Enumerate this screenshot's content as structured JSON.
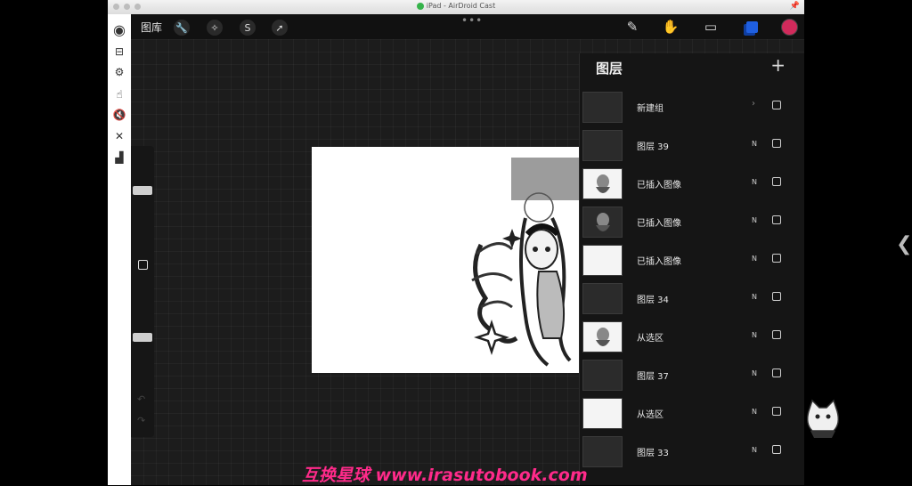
{
  "window": {
    "title": "iPad - AirDroid Cast"
  },
  "topbar": {
    "gallery_label": "图库",
    "tools_left": [
      "wrench-icon",
      "magic-wand-icon",
      "selection-icon",
      "transform-arrow-icon"
    ],
    "tools_right": [
      "brush-icon",
      "smudge-icon",
      "eraser-icon",
      "layers-icon",
      "color-swatch"
    ],
    "active_color": "#d12a5b",
    "layers_icon_color": "#1f5fe0"
  },
  "layers_panel": {
    "title": "图层",
    "add_icon": "plus-icon",
    "layers": [
      {
        "name": "新建组",
        "blend": "",
        "group": true,
        "thumb": "dark"
      },
      {
        "name": "图层 39",
        "blend": "N",
        "thumb": "dark"
      },
      {
        "name": "已插入图像",
        "blend": "N",
        "thumb": "art"
      },
      {
        "name": "已插入图像",
        "blend": "N",
        "thumb": "art-dark"
      },
      {
        "name": "已插入图像",
        "blend": "N",
        "thumb": "white"
      },
      {
        "name": "图层 34",
        "blend": "N",
        "thumb": "dark"
      },
      {
        "name": "从选区",
        "blend": "N",
        "thumb": "art"
      },
      {
        "name": "图层 37",
        "blend": "N",
        "thumb": "dark"
      },
      {
        "name": "从选区",
        "blend": "N",
        "thumb": "white"
      },
      {
        "name": "图层 33",
        "blend": "N",
        "thumb": "dark"
      }
    ]
  },
  "watermark": "互换星球 www.irasutobook.com"
}
